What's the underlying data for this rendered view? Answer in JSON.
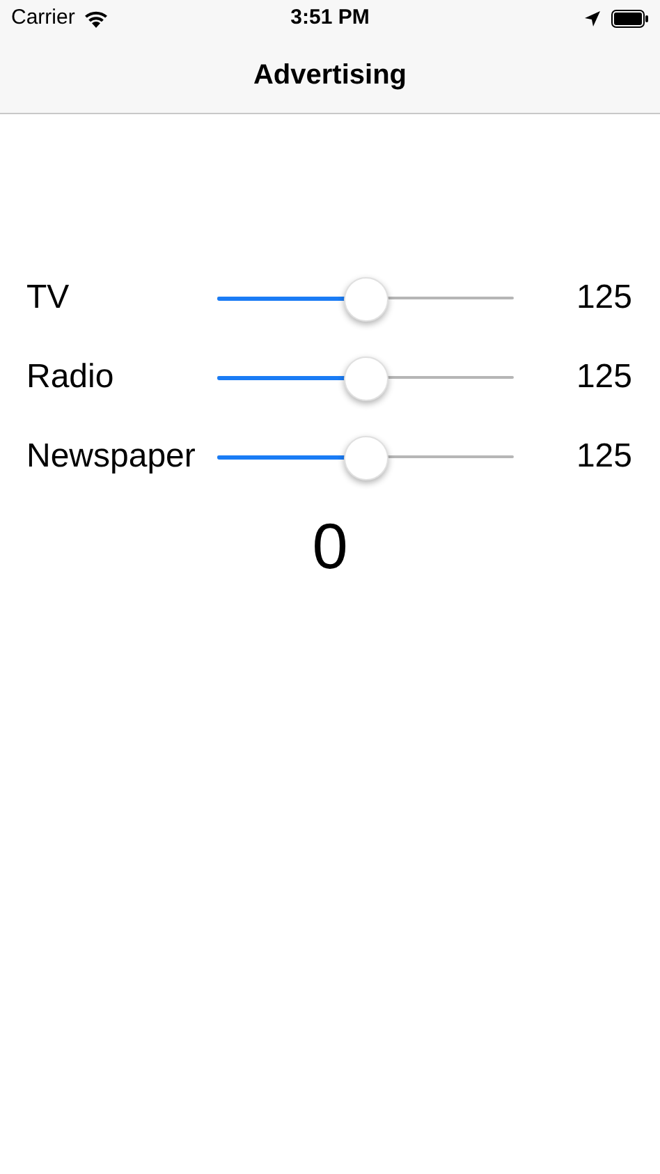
{
  "status_bar": {
    "carrier": "Carrier",
    "time": "3:51 PM"
  },
  "nav_bar": {
    "title": "Advertising"
  },
  "sliders": [
    {
      "label": "TV",
      "level": 0.5,
      "reading": "125"
    },
    {
      "label": "Radio",
      "level": 0.5,
      "reading": "125"
    },
    {
      "label": "Newspaper",
      "level": 0.5,
      "reading": "125"
    }
  ],
  "result": "0"
}
